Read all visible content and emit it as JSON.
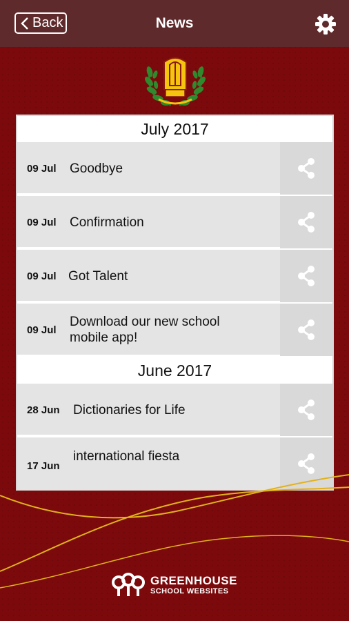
{
  "header": {
    "back_label": "Back",
    "title": "News"
  },
  "sections": [
    {
      "month": "July 2017",
      "items": [
        {
          "date": "09 Jul",
          "title": "Goodbye"
        },
        {
          "date": "09 Jul",
          "title": "Confirmation"
        },
        {
          "date": "09 Jul",
          "title": "Got Talent"
        },
        {
          "date": "09 Jul",
          "title": "Download our new school mobile app!"
        }
      ]
    },
    {
      "month": "June 2017",
      "items": [
        {
          "date": "28 Jun",
          "title": "Dictionaries for Life"
        },
        {
          "date": "17 Jun",
          "title": "international fiesta"
        }
      ]
    }
  ],
  "footer": {
    "brand_name": "GREENHOUSE",
    "brand_sub": "SCHOOL WEBSITES"
  },
  "colors": {
    "background": "#7c0a0c",
    "header": "#5e2a2b",
    "row": "#e4e4e4",
    "share_cell": "#d9d9d9",
    "share_icon": "#ffffff",
    "swoosh": "#e2b21b"
  },
  "icons": {
    "back": "chevron-left-icon",
    "settings": "gear-icon",
    "share": "share-icon",
    "crest": "school-crest-icon"
  }
}
